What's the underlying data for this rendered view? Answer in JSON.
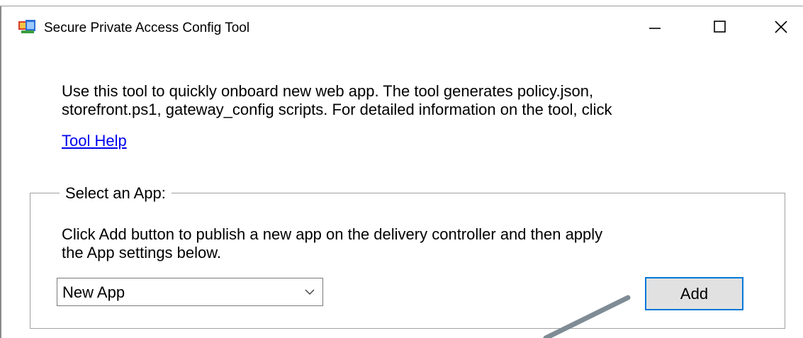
{
  "window": {
    "title": "Secure Private Access Config Tool",
    "icon": "winforms-app-icon",
    "controls": {
      "minimize": "minimize-icon",
      "maximize": "maximize-icon",
      "close": "close-icon"
    }
  },
  "intro": {
    "line1": "Use this tool to quickly onboard new web app. The tool generates policy.json,",
    "line2": "storefront.ps1, gateway_config scripts. For detailed information on the tool, click"
  },
  "help_link": {
    "label": "Tool Help"
  },
  "app_group": {
    "legend": "Select an App:",
    "desc_line1": "Click Add button to publish a new app on the delivery controller and then apply",
    "desc_line2": "the App settings below.",
    "app_select": {
      "value": "New App",
      "icon": "chevron-down-icon"
    },
    "add_label": "Add"
  },
  "colors": {
    "link": "#0000ee",
    "button_focus_border": "#0078d7",
    "button_face": "#e1e1e1",
    "pointer_arrow": "#7f8c95"
  }
}
